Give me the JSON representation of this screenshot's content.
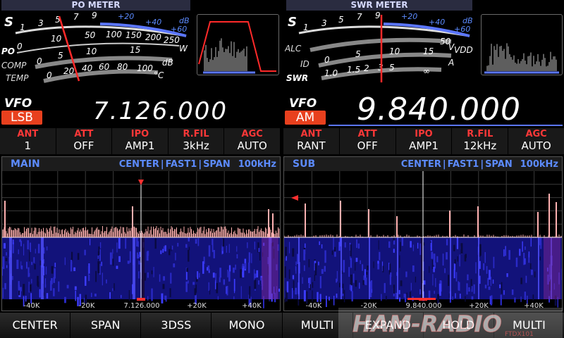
{
  "meters": {
    "po": {
      "title": "PO METER",
      "s_label": "S",
      "s_scale": [
        "1",
        "3",
        "5",
        "7",
        "9",
        "+20",
        "+40",
        "+60"
      ],
      "db_label": "dB",
      "po_label": "PO",
      "po_scale": [
        "0",
        "10",
        "50",
        "100",
        "150",
        "200",
        "250"
      ],
      "po_unit": "W",
      "comp_label": "COMP",
      "comp_scale": [
        "0",
        "5",
        "10",
        "15"
      ],
      "comp_unit": "dB",
      "temp_label": "TEMP",
      "temp_scale": [
        "0",
        "20",
        "40",
        "60",
        "80",
        "100"
      ],
      "temp_unit": "°C"
    },
    "swr": {
      "title": "SWR METER",
      "s_label": "S",
      "s_scale": [
        "1",
        "3",
        "5",
        "7",
        "9",
        "+20",
        "+40",
        "+60"
      ],
      "db_label": "dB",
      "alc_label": "ALC",
      "id_label": "ID",
      "id_scale": [
        "0",
        "5",
        "10",
        "15"
      ],
      "id_unit": "A",
      "vdd_scale": [
        "50"
      ],
      "vdd_unit_v": "V",
      "vdd_label": "VDD",
      "swr_label": "SWR",
      "swr_scale": [
        "1.0",
        "1.5",
        "2",
        "3",
        "5",
        "∞"
      ]
    }
  },
  "vfo_main": {
    "label": "VFO",
    "mode": "LSB",
    "frequency": "7.126.000",
    "settings": [
      {
        "label": "ANT",
        "value": "1"
      },
      {
        "label": "ATT",
        "value": "OFF"
      },
      {
        "label": "IPO",
        "value": "AMP1"
      },
      {
        "label": "R.FIL",
        "value": "3kHz"
      },
      {
        "label": "AGC",
        "value": "AUTO"
      }
    ]
  },
  "vfo_sub": {
    "label": "VFO",
    "mode": "AM",
    "frequency": "9.840.000",
    "settings": [
      {
        "label": "ANT",
        "value": "RANT"
      },
      {
        "label": "ATT",
        "value": "OFF"
      },
      {
        "label": "IPO",
        "value": "AMP1"
      },
      {
        "label": "R.FIL",
        "value": "12kHz"
      },
      {
        "label": "AGC",
        "value": "AUTO"
      }
    ]
  },
  "scope_main": {
    "name": "MAIN",
    "mode": "CENTER",
    "speed": "FAST1",
    "span_label": "SPAN",
    "span_value": "100kHz",
    "separator": "|",
    "axis": [
      "-40K",
      "-20K",
      "7.126.000",
      "+20K",
      "+40K"
    ]
  },
  "scope_sub": {
    "name": "SUB",
    "mode": "CENTER",
    "speed": "FAST1",
    "span_label": "SPAN",
    "span_value": "100kHz",
    "separator": "|",
    "axis": [
      "-40K",
      "-20K",
      "9.840.000",
      "+20K",
      "+40K"
    ]
  },
  "function_bar": [
    "CENTER",
    "SPAN",
    "3DSS",
    "MONO",
    "MULTI",
    "EXPAND",
    "HOLD",
    "MULTI"
  ],
  "watermark": {
    "text": "HAM-RADIO",
    "subtext": "FTDX101"
  },
  "colors": {
    "accent_blue": "#5c8bff",
    "label_red": "#ff3838",
    "mode_orange": "#e8401e",
    "needle_red": "#ff2a2a",
    "spectrum_pink": "#ffb0b0",
    "waterfall_blue": "#1a1a8c"
  }
}
